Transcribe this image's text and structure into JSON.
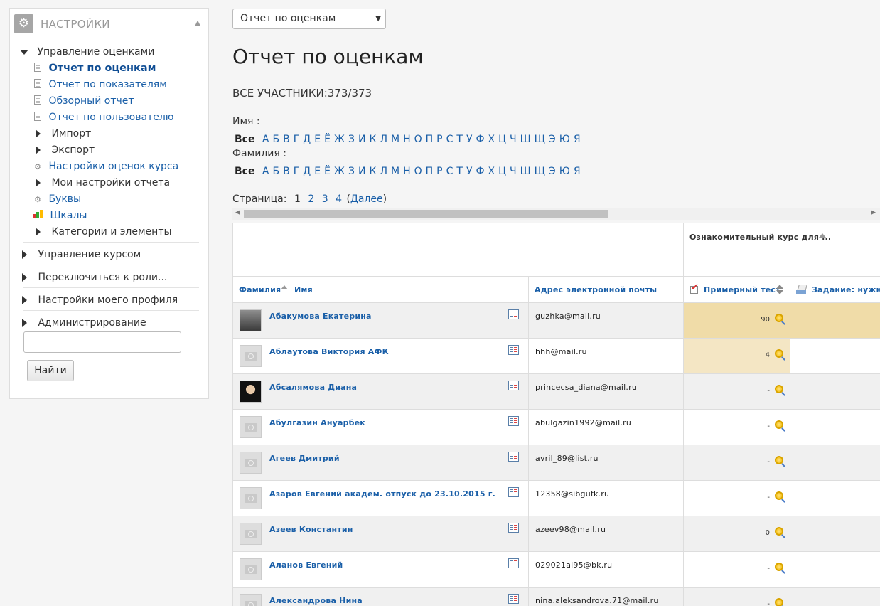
{
  "sidebar": {
    "title": "НАСТРОЙКИ",
    "grade_admin": {
      "label": "Управление оценками",
      "items": [
        {
          "label": "Отчет по оценкам",
          "kind": "doc",
          "active": true
        },
        {
          "label": "Отчет по показателям",
          "kind": "doc"
        },
        {
          "label": "Обзорный отчет",
          "kind": "doc"
        },
        {
          "label": "Отчет по пользователю",
          "kind": "doc"
        },
        {
          "label": "Импорт",
          "kind": "folder"
        },
        {
          "label": "Экспорт",
          "kind": "folder"
        },
        {
          "label": "Настройки оценок курса",
          "kind": "settings"
        },
        {
          "label": "Мои настройки отчета",
          "kind": "folder"
        },
        {
          "label": "Буквы",
          "kind": "settings"
        },
        {
          "label": "Шкалы",
          "kind": "scale"
        },
        {
          "label": "Категории и элементы",
          "kind": "folder"
        }
      ]
    },
    "sections": [
      {
        "label": "Управление курсом"
      },
      {
        "label": "Переключиться к роли..."
      },
      {
        "label": "Настройки моего профиля"
      },
      {
        "label": "Администрирование"
      }
    ],
    "search": {
      "value": "",
      "button": "Найти"
    }
  },
  "main": {
    "select_value": "Отчет по оценкам",
    "title": "Отчет по оценкам",
    "participants": "ВСЕ УЧАСТНИКИ:373/373",
    "first_name_label": "Имя :",
    "last_name_label": "Фамилия :",
    "all_label": "Все",
    "letters": [
      "А",
      "Б",
      "В",
      "Г",
      "Д",
      "Е",
      "Ё",
      "Ж",
      "З",
      "И",
      "К",
      "Л",
      "М",
      "Н",
      "О",
      "П",
      "Р",
      "С",
      "Т",
      "У",
      "Ф",
      "Х",
      "Ц",
      "Ч",
      "Ш",
      "Щ",
      "Э",
      "Ю",
      "Я"
    ],
    "pager": {
      "label": "Страница:",
      "current": "1",
      "pages": [
        "2",
        "3",
        "4"
      ],
      "next": "Далее",
      "open_paren": "(",
      "close_paren": ")"
    }
  },
  "table": {
    "course_header": "Ознакомительный курс для ...",
    "col_lastname": "Фамилия",
    "col_firstname": "Имя",
    "col_email": "Адрес электронной почты",
    "col_quiz": "Примерный тест",
    "col_assign": "Задание: нужно",
    "rows": [
      {
        "name": "Абакумова Екатерина",
        "email": "guzhka@mail.ru",
        "grade": "90",
        "avatar": "photo1",
        "highlight": "strong"
      },
      {
        "name": "Аблаутова Виктория АФК",
        "email": "hhh@mail.ru",
        "grade": "4",
        "avatar": "none",
        "highlight": "light"
      },
      {
        "name": "Абсалямова Диана",
        "email": "princecsa_diana@mail.ru",
        "grade": "-",
        "avatar": "photo2",
        "highlight": ""
      },
      {
        "name": "Абулгазин Ануарбек",
        "email": "abulgazin1992@mail.ru",
        "grade": "-",
        "avatar": "none",
        "highlight": ""
      },
      {
        "name": "Агеев Дмитрий",
        "email": "avril_89@list.ru",
        "grade": "-",
        "avatar": "none",
        "highlight": ""
      },
      {
        "name": "Азаров Евгений академ. отпуск до 23.10.2015 г.",
        "email": "12358@sibgufk.ru",
        "grade": "-",
        "avatar": "none",
        "highlight": ""
      },
      {
        "name": "Азеев Константин",
        "email": "azeev98@mail.ru",
        "grade": "0",
        "avatar": "none",
        "highlight": ""
      },
      {
        "name": "Аланов Евгений",
        "email": "029021al95@bk.ru",
        "grade": "-",
        "avatar": "none",
        "highlight": ""
      },
      {
        "name": "Александрова Нина",
        "email": "nina.aleksandrova.71@mail.ru",
        "grade": "-",
        "avatar": "none",
        "highlight": ""
      }
    ]
  },
  "colors": {
    "link": "#1a5fa8",
    "highlight_strong": "#f0dca8",
    "highlight_light": "#f4e6c4"
  }
}
